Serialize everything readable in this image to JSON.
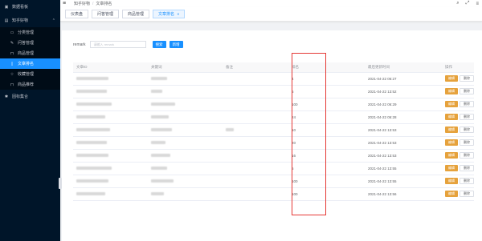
{
  "sidebar": {
    "items": [
      {
        "label": "数据看板",
        "icon": "dashboard-icon"
      },
      {
        "label": "知乎好物",
        "icon": "box-icon",
        "expanded": true,
        "children": [
          {
            "label": "分类管理",
            "icon": "folder-icon"
          },
          {
            "label": "问答管理",
            "icon": "edit-icon"
          },
          {
            "label": "商品管理",
            "icon": "bag-icon"
          },
          {
            "label": "文章排名",
            "icon": "document-icon",
            "active": true
          },
          {
            "label": "收藏管理",
            "icon": "star-icon"
          },
          {
            "label": "商品推荐",
            "icon": "bag-icon"
          }
        ]
      },
      {
        "label": "固标集合",
        "icon": "settings-icon"
      }
    ]
  },
  "header": {
    "breadcrumb": [
      "知乎好物",
      "文章排名"
    ]
  },
  "tags": [
    {
      "label": "仪表盘",
      "active": false
    },
    {
      "label": "问答管理",
      "active": false
    },
    {
      "label": "商品管理",
      "active": false
    },
    {
      "label": "文章排名",
      "active": true
    }
  ],
  "filter": {
    "label": "remark",
    "placeholder": "请输入 remark",
    "search_label": "搜索",
    "add_label": "新增"
  },
  "table": {
    "headers": [
      "文章ID",
      "关键词",
      "备注",
      "排名",
      "最后更新时间",
      "操作"
    ],
    "edit_label": "编辑",
    "delete_label": "删除",
    "rows": [
      {
        "rank": "4",
        "updated": "2021-04-22 06:27"
      },
      {
        "rank": "5",
        "updated": "2021-04-22 13:52"
      },
      {
        "rank": "100",
        "updated": "2021-04-22 06:29"
      },
      {
        "rank": "24",
        "updated": "2021-04-22 06:28"
      },
      {
        "rank": "10",
        "updated": "2021-04-22 13:53"
      },
      {
        "rank": "20",
        "updated": "2021-04-22 13:53"
      },
      {
        "rank": "16",
        "updated": "2021-04-22 13:53"
      },
      {
        "rank": "5",
        "updated": "2021-04-22 13:55"
      },
      {
        "rank": "100",
        "updated": "2021-04-22 13:55"
      },
      {
        "rank": "100",
        "updated": "2021-04-22 13:56"
      }
    ]
  },
  "colors": {
    "sidebar_bg": "#001529",
    "accent": "#1890ff",
    "edit_button": "#e6a23c",
    "highlight_border": "#e53935"
  }
}
